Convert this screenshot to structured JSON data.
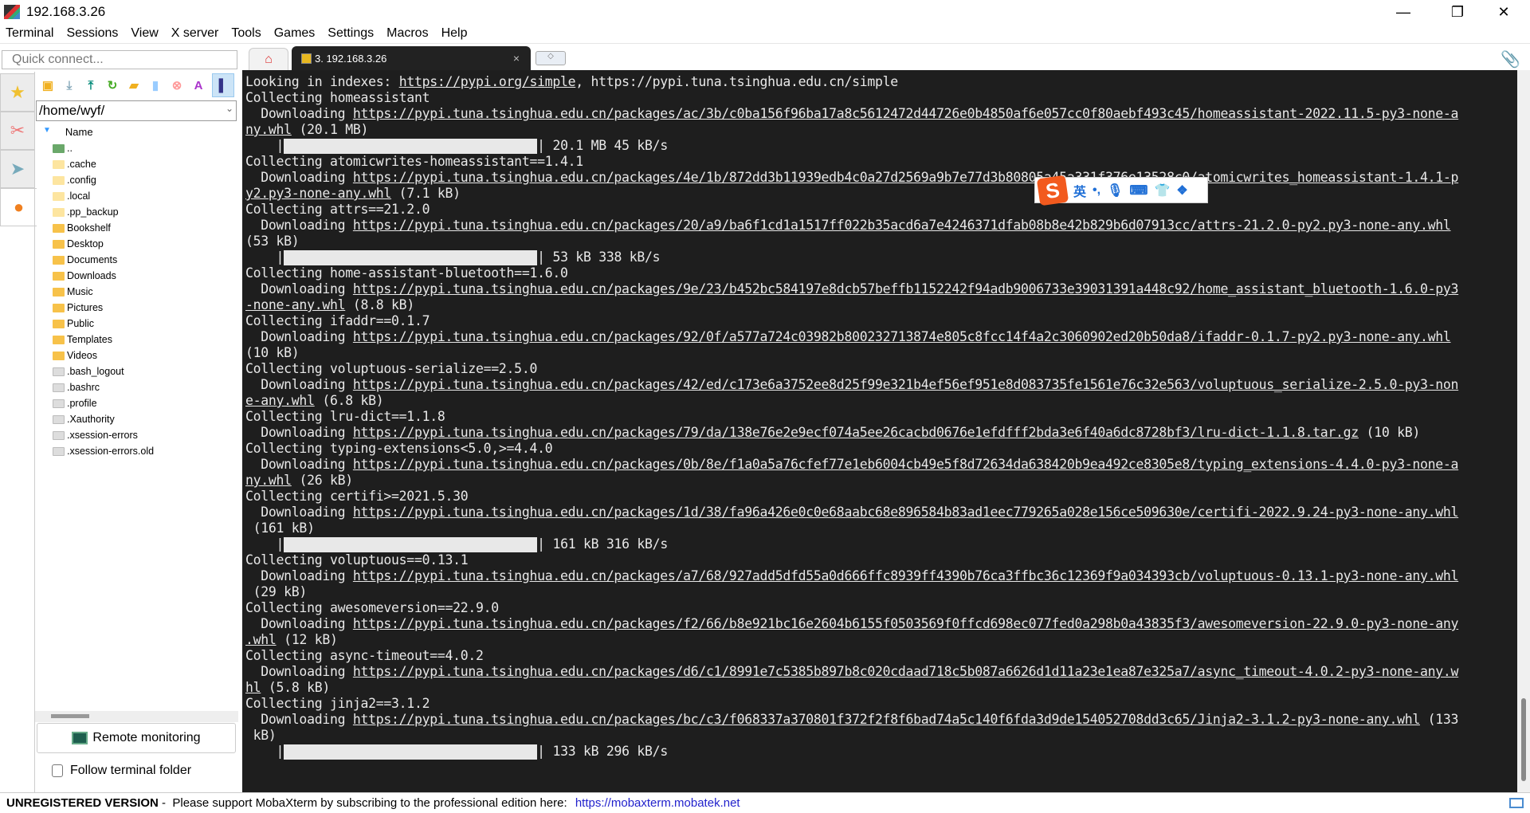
{
  "window": {
    "title": "192.168.3.26"
  },
  "menu": [
    "Terminal",
    "Sessions",
    "View",
    "X server",
    "Tools",
    "Games",
    "Settings",
    "Macros",
    "Help"
  ],
  "quick_connect": {
    "placeholder": "Quick connect..."
  },
  "sidebar": {
    "path": "/home/wyf/",
    "column_header": "Name",
    "files": [
      {
        "name": "..",
        "type": "parent"
      },
      {
        "name": ".cache",
        "type": "hidden"
      },
      {
        "name": ".config",
        "type": "hidden"
      },
      {
        "name": ".local",
        "type": "hidden"
      },
      {
        "name": ".pp_backup",
        "type": "hidden"
      },
      {
        "name": "Bookshelf",
        "type": "folder"
      },
      {
        "name": "Desktop",
        "type": "folder"
      },
      {
        "name": "Documents",
        "type": "folder"
      },
      {
        "name": "Downloads",
        "type": "folder"
      },
      {
        "name": "Music",
        "type": "folder"
      },
      {
        "name": "Pictures",
        "type": "folder"
      },
      {
        "name": "Public",
        "type": "folder"
      },
      {
        "name": "Templates",
        "type": "folder"
      },
      {
        "name": "Videos",
        "type": "folder"
      },
      {
        "name": ".bash_logout",
        "type": "file"
      },
      {
        "name": ".bashrc",
        "type": "file"
      },
      {
        "name": ".profile",
        "type": "file"
      },
      {
        "name": ".Xauthority",
        "type": "file"
      },
      {
        "name": ".xsession-errors",
        "type": "file"
      },
      {
        "name": ".xsession-errors.old",
        "type": "file"
      }
    ],
    "remote_monitoring": "Remote monitoring",
    "follow_terminal_folder": "Follow terminal folder"
  },
  "tabs": {
    "session": "3. 192.168.3.26",
    "close": "×"
  },
  "ime": {
    "lang": "英",
    "punct": "•,"
  },
  "terminal": {
    "lines": [
      {
        "t": "Looking in indexes: ",
        "u": "https://pypi.org/simple",
        "a": ", https://pypi.tuna.tsinghua.edu.cn/simple"
      },
      {
        "t": "Collecting homeassistant"
      },
      {
        "t": "  Downloading ",
        "u": "https://pypi.tuna.tsinghua.edu.cn/packages/ac/3b/c0ba156f96ba17a8c5612472d44726e0b4850af6e057cc0f80aebf493c45/homeassistant-2022.11.5-py3-none-a"
      },
      {
        "u": "ny.whl",
        "a": " (20.1 MB)"
      },
      {
        "bar": true,
        "a": "| 20.1 MB 45 kB/s"
      },
      {
        "t": "Collecting atomicwrites-homeassistant==1.4.1"
      },
      {
        "t": "  Downloading ",
        "u": "https://pypi.tuna.tsinghua.edu.cn/packages/4e/1b/872dd3b11939edb4c0a27d2569a9b7e77d3b80805a45a331f376e13528c0/atomicwrites_homeassistant-1.4.1-p"
      },
      {
        "u": "y2.py3-none-any.whl",
        "a": " (7.1 kB)"
      },
      {
        "t": "Collecting attrs==21.2.0"
      },
      {
        "t": "  Downloading ",
        "u": "https://pypi.tuna.tsinghua.edu.cn/packages/20/a9/ba6f1cd1a1517ff022b35acd6a7e4246371dfab08b8e42b829b6d07913cc/attrs-21.2.0-py2.py3-none-any.whl"
      },
      {
        "t": "(53 kB)"
      },
      {
        "bar": true,
        "a": "| 53 kB 338 kB/s"
      },
      {
        "t": "Collecting home-assistant-bluetooth==1.6.0"
      },
      {
        "t": "  Downloading ",
        "u": "https://pypi.tuna.tsinghua.edu.cn/packages/9e/23/b452bc584197e8dcb57beffb1152242f94adb9006733e39031391a448c92/home_assistant_bluetooth-1.6.0-py3"
      },
      {
        "u": "-none-any.whl",
        "a": " (8.8 kB)"
      },
      {
        "t": "Collecting ifaddr==0.1.7"
      },
      {
        "t": "  Downloading ",
        "u": "https://pypi.tuna.tsinghua.edu.cn/packages/92/0f/a577a724c03982b800232713874e805c8fcc14f4a2c3060902ed20b50da8/ifaddr-0.1.7-py2.py3-none-any.whl"
      },
      {
        "t": "(10 kB)"
      },
      {
        "t": "Collecting voluptuous-serialize==2.5.0"
      },
      {
        "t": "  Downloading ",
        "u": "https://pypi.tuna.tsinghua.edu.cn/packages/42/ed/c173e6a3752ee8d25f99e321b4ef56ef951e8d083735fe1561e76c32e563/voluptuous_serialize-2.5.0-py3-non"
      },
      {
        "u": "e-any.whl",
        "a": " (6.8 kB)"
      },
      {
        "t": "Collecting lru-dict==1.1.8"
      },
      {
        "t": "  Downloading ",
        "u": "https://pypi.tuna.tsinghua.edu.cn/packages/79/da/138e76e2e9ecf074a5ee26cacbd0676e1efdfff2bda3e6f40a6dc8728bf3/lru-dict-1.1.8.tar.gz",
        "a": " (10 kB)"
      },
      {
        "t": "Collecting typing-extensions<5.0,>=4.4.0"
      },
      {
        "t": "  Downloading ",
        "u": "https://pypi.tuna.tsinghua.edu.cn/packages/0b/8e/f1a0a5a76cfef77e1eb6004cb49e5f8d72634da638420b9ea492ce8305e8/typing_extensions-4.4.0-py3-none-a"
      },
      {
        "u": "ny.whl",
        "a": " (26 kB)"
      },
      {
        "t": "Collecting certifi>=2021.5.30"
      },
      {
        "t": "  Downloading ",
        "u": "https://pypi.tuna.tsinghua.edu.cn/packages/1d/38/fa96a426e0c0e68aabc68e896584b83ad1eec779265a028e156ce509630e/certifi-2022.9.24-py3-none-any.whl"
      },
      {
        "t": " (161 kB)"
      },
      {
        "bar": true,
        "a": "| 161 kB 316 kB/s"
      },
      {
        "t": "Collecting voluptuous==0.13.1"
      },
      {
        "t": "  Downloading ",
        "u": "https://pypi.tuna.tsinghua.edu.cn/packages/a7/68/927add5dfd55a0d666ffc8939ff4390b76ca3ffbc36c12369f9a034393cb/voluptuous-0.13.1-py3-none-any.whl"
      },
      {
        "t": " (29 kB)"
      },
      {
        "t": "Collecting awesomeversion==22.9.0"
      },
      {
        "t": "  Downloading ",
        "u": "https://pypi.tuna.tsinghua.edu.cn/packages/f2/66/b8e921bc16e2604b6155f0503569f0ffcd698ec077fed0a298b0a43835f3/awesomeversion-22.9.0-py3-none-any"
      },
      {
        "u": ".whl",
        "a": " (12 kB)"
      },
      {
        "t": "Collecting async-timeout==4.0.2"
      },
      {
        "t": "  Downloading ",
        "u": "https://pypi.tuna.tsinghua.edu.cn/packages/d6/c1/8991e7c5385b897b8c020cdaad718c5b087a6626d1d11a23e1ea87e325a7/async_timeout-4.0.2-py3-none-any.w"
      },
      {
        "u": "hl",
        "a": " (5.8 kB)"
      },
      {
        "t": "Collecting jinja2==3.1.2"
      },
      {
        "t": "  Downloading ",
        "u": "https://pypi.tuna.tsinghua.edu.cn/packages/bc/c3/f068337a370801f372f2f8f6bad74a5c140f6fda3d9de154052708dd3c65/Jinja2-3.1.2-py3-none-any.whl",
        "a": " (133"
      },
      {
        "t": " kB)"
      },
      {
        "bar": true,
        "a": "| 133 kB 296 kB/s"
      }
    ]
  },
  "status": {
    "unregistered": "UNREGISTERED VERSION",
    "message": " -  Please support MobaXterm by subscribing to the professional edition here: ",
    "link": "https://mobaxterm.mobatek.net"
  }
}
